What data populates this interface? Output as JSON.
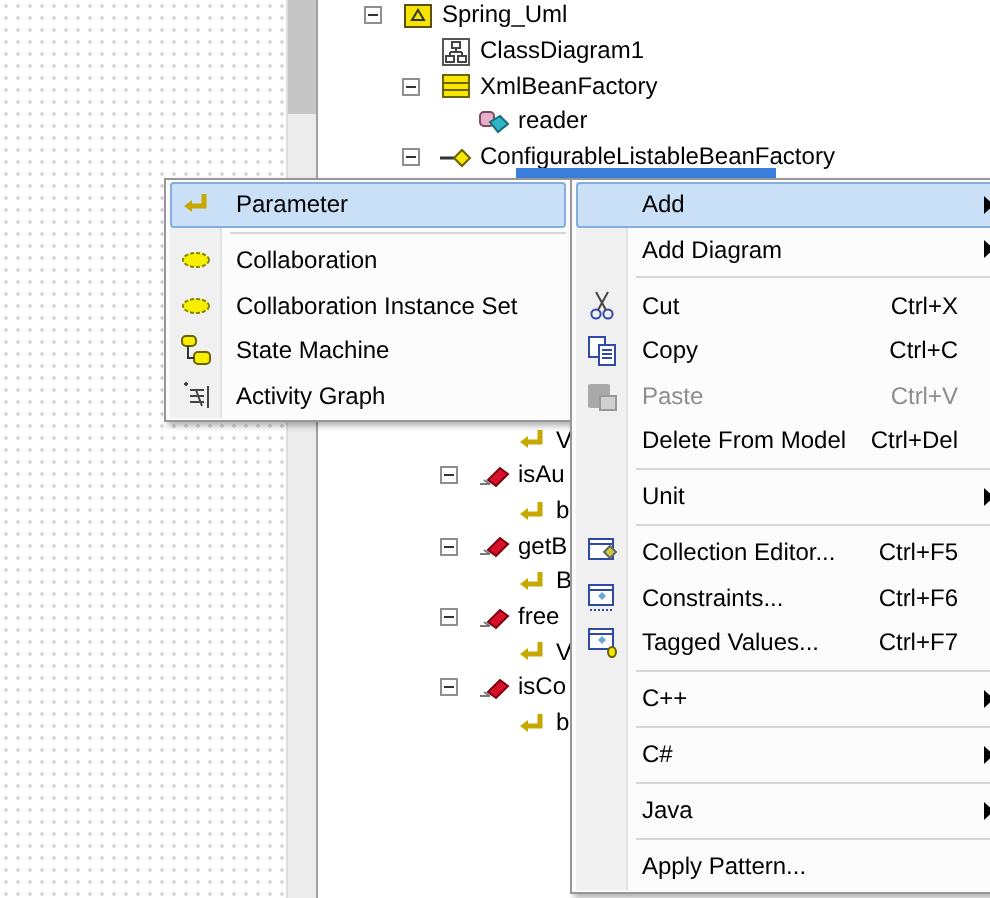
{
  "tree": [
    {
      "label": "Spring_Uml",
      "kind": "package",
      "expanded": true,
      "selected": false,
      "children": [
        {
          "label": "ClassDiagram1",
          "kind": "diagram",
          "selected": false
        },
        {
          "label": "XmlBeanFactory",
          "kind": "class",
          "expanded": true,
          "selected": false,
          "children": [
            {
              "label": "reader",
              "kind": "attribute",
              "selected": false
            }
          ]
        },
        {
          "label": "ConfigurableListableBeanFactory",
          "kind": "interface",
          "expanded": true,
          "selected": false,
          "children": [
            {
              "kind": "operation",
              "selected": true
            },
            {
              "kind": "operation",
              "selected": false,
              "children": [
                {
                  "label": "V",
                  "kind": "parameter",
                  "selected": false
                }
              ]
            },
            {
              "label": "isAu",
              "kind": "operation",
              "expanded": true,
              "selected": false,
              "children": [
                {
                  "label": "b",
                  "kind": "parameter",
                  "selected": false
                }
              ]
            },
            {
              "label": "getB",
              "kind": "operation",
              "expanded": true,
              "selected": false,
              "children": [
                {
                  "label": "B",
                  "kind": "parameter",
                  "selected": false
                }
              ]
            },
            {
              "label": "free",
              "kind": "operation",
              "expanded": true,
              "selected": false,
              "children": [
                {
                  "label": "V",
                  "kind": "parameter",
                  "selected": false
                }
              ]
            },
            {
              "label": "isCo",
              "kind": "operation",
              "expanded": true,
              "selected": false,
              "children": [
                {
                  "label": "b",
                  "kind": "parameter",
                  "selected": false
                }
              ]
            }
          ]
        }
      ]
    }
  ],
  "submenu": [
    {
      "kind": "item",
      "label": "Parameter",
      "selected": true
    },
    {
      "kind": "separator"
    },
    {
      "kind": "item",
      "label": "Collaboration",
      "selected": false
    },
    {
      "kind": "item",
      "label": "Collaboration Instance Set",
      "selected": false
    },
    {
      "kind": "item",
      "label": "State Machine",
      "selected": false
    },
    {
      "kind": "item",
      "label": "Activity Graph",
      "selected": false
    }
  ],
  "context_menu": [
    {
      "kind": "item",
      "label": "Add",
      "submenu": true,
      "selected": true,
      "disabled": false
    },
    {
      "kind": "item",
      "label": "Add Diagram",
      "submenu": true,
      "selected": false,
      "disabled": false
    },
    {
      "kind": "separator"
    },
    {
      "kind": "item",
      "label": "Cut",
      "shortcut": "Ctrl+X",
      "submenu": false,
      "selected": false,
      "disabled": false
    },
    {
      "kind": "item",
      "label": "Copy",
      "shortcut": "Ctrl+C",
      "submenu": false,
      "selected": false,
      "disabled": false
    },
    {
      "kind": "item",
      "label": "Paste",
      "shortcut": "Ctrl+V",
      "submenu": false,
      "selected": false,
      "disabled": true
    },
    {
      "kind": "item",
      "label": "Delete From Model",
      "shortcut": "Ctrl+Del",
      "submenu": false,
      "selected": false,
      "disabled": false
    },
    {
      "kind": "separator"
    },
    {
      "kind": "item",
      "label": "Unit",
      "submenu": true,
      "selected": false,
      "disabled": false
    },
    {
      "kind": "separator"
    },
    {
      "kind": "item",
      "label": "Collection Editor...",
      "shortcut": "Ctrl+F5",
      "submenu": false,
      "selected": false,
      "disabled": false
    },
    {
      "kind": "item",
      "label": "Constraints...",
      "shortcut": "Ctrl+F6",
      "submenu": false,
      "selected": false,
      "disabled": false
    },
    {
      "kind": "item",
      "label": "Tagged Values...",
      "shortcut": "Ctrl+F7",
      "submenu": false,
      "selected": false,
      "disabled": false
    },
    {
      "kind": "separator"
    },
    {
      "kind": "item",
      "label": "C++",
      "submenu": true,
      "selected": false,
      "disabled": false
    },
    {
      "kind": "separator"
    },
    {
      "kind": "item",
      "label": "C#",
      "submenu": true,
      "selected": false,
      "disabled": false
    },
    {
      "kind": "separator"
    },
    {
      "kind": "item",
      "label": "Java",
      "submenu": true,
      "selected": false,
      "disabled": false
    },
    {
      "kind": "separator"
    },
    {
      "kind": "item",
      "label": "Apply Pattern...",
      "submenu": false,
      "selected": false,
      "disabled": false
    }
  ]
}
